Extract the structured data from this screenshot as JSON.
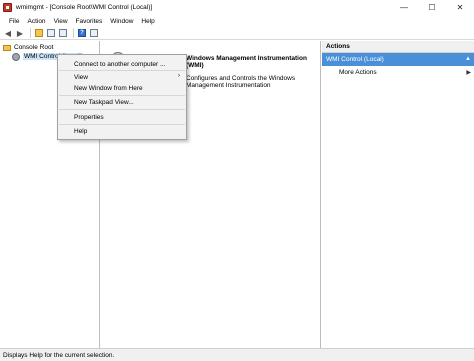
{
  "window": {
    "title": "wmimgmt - [Console Root\\WMI Control (Local)]",
    "minimize_glyph": "—",
    "maximize_glyph": "☐",
    "close_glyph": "✕"
  },
  "menubar": {
    "items": [
      "File",
      "Action",
      "View",
      "Favorites",
      "Window",
      "Help"
    ]
  },
  "toolbar": {
    "back_glyph": "◀",
    "forward_glyph": "▶",
    "help_glyph": "?"
  },
  "tree": {
    "root_label": "Console Root",
    "child_label": "WMI Control (Local)"
  },
  "center": {
    "heading": "Windows Management Instrumentation (WMI)",
    "description": "Configures and Controls the Windows Management Instrumentation"
  },
  "actions": {
    "header": "Actions",
    "section_label": "WMI Control (Local)",
    "section_arrow": "▲",
    "more_actions": "More Actions",
    "more_arrow": "▶"
  },
  "context_menu": {
    "connect": "Connect to another computer ...",
    "view": "View",
    "view_arrow": "›",
    "new_window": "New Window from Here",
    "new_taskpad": "New Taskpad View...",
    "properties": "Properties",
    "help": "Help"
  },
  "statusbar": {
    "text": "Displays Help for the current selection."
  },
  "colors": {
    "selection": "#cce4f7",
    "actions_section": "#4a90d9",
    "menu_background": "#f2f2f2"
  },
  "icons": [
    "app-icon",
    "back-icon",
    "forward-icon",
    "folder-icon",
    "wmi-icon",
    "help-icon"
  ]
}
